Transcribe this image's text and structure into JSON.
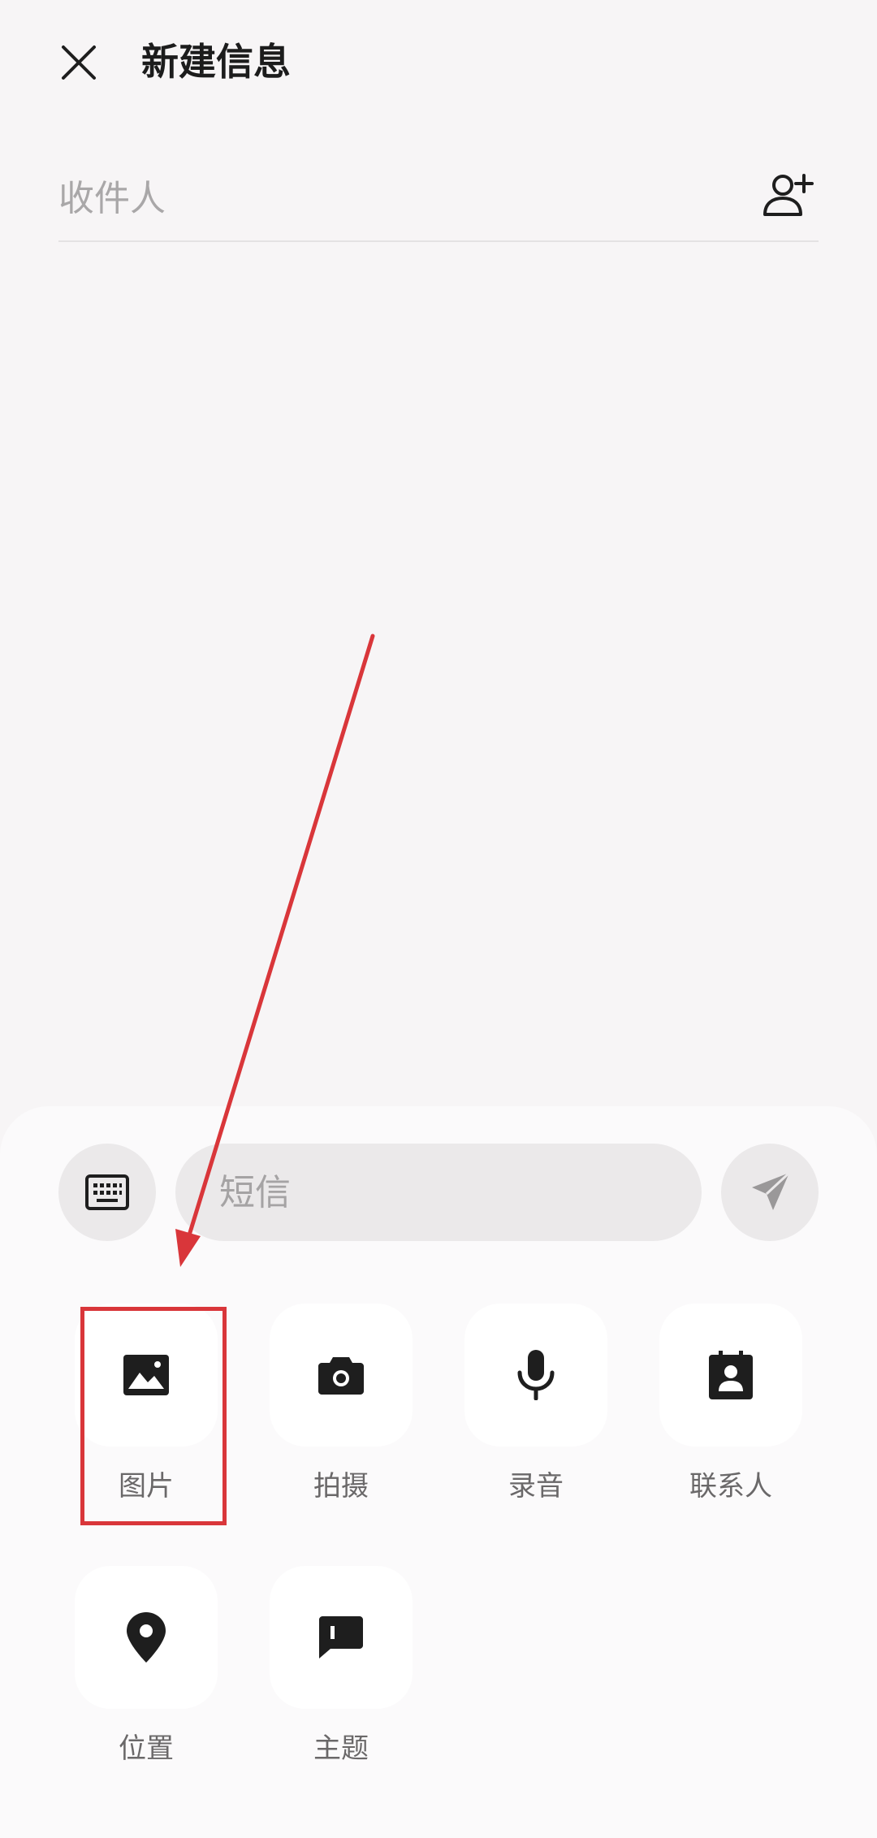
{
  "header": {
    "title": "新建信息",
    "close_icon": "close-icon"
  },
  "recipient": {
    "placeholder": "收件人",
    "value": "",
    "add_icon": "add-contact-icon"
  },
  "compose": {
    "keyboard_icon": "keyboard-icon",
    "sms_placeholder": "短信",
    "sms_value": "",
    "send_icon": "send-icon"
  },
  "attachments": [
    {
      "label": "图片",
      "icon": "image-icon"
    },
    {
      "label": "拍摄",
      "icon": "camera-icon"
    },
    {
      "label": "录音",
      "icon": "microphone-icon"
    },
    {
      "label": "联系人",
      "icon": "contact-card-icon"
    },
    {
      "label": "位置",
      "icon": "location-pin-icon"
    },
    {
      "label": "主题",
      "icon": "subject-icon"
    }
  ],
  "colors": {
    "background": "#f7f5f6",
    "panel": "#fbfafb",
    "pill": "#ebe9ea",
    "annotation": "#d9363a"
  }
}
